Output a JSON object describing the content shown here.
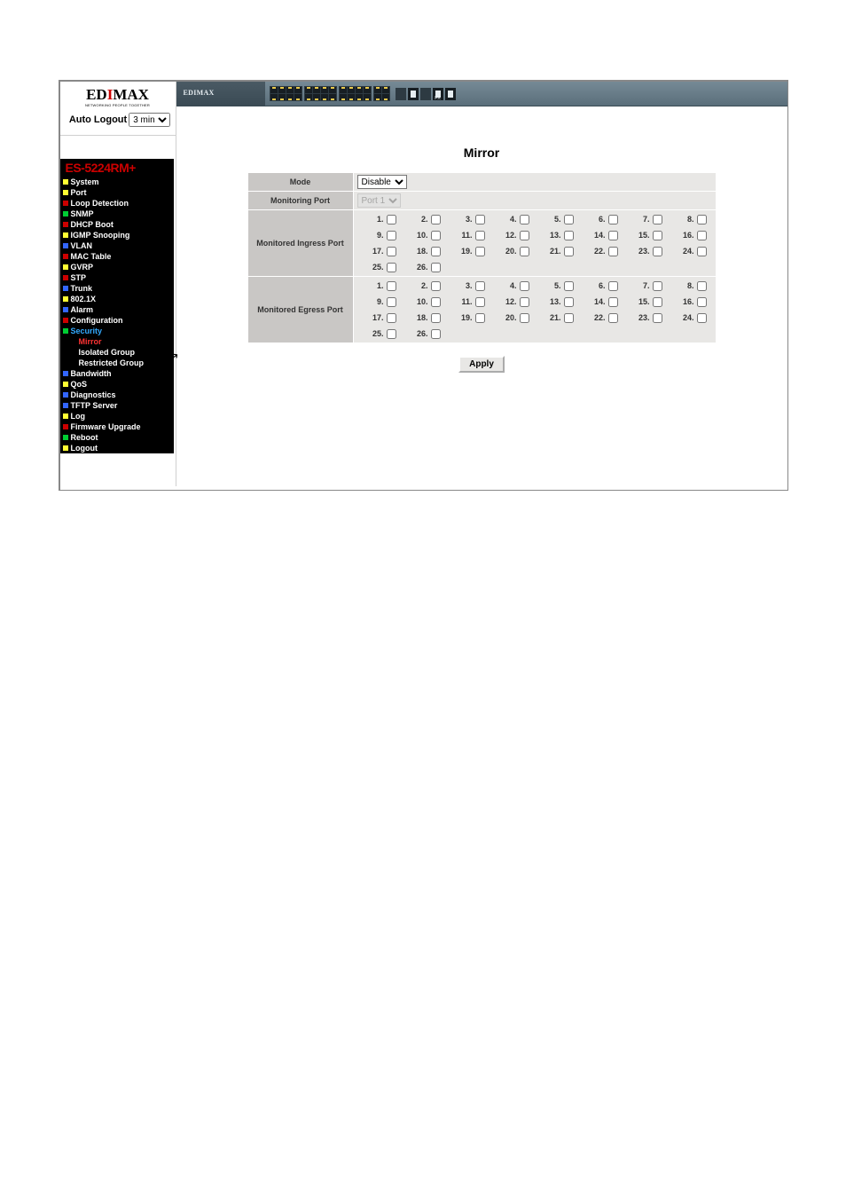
{
  "brand": "EDIMAX",
  "auto_logout_label": "Auto Logout",
  "auto_logout_value": "3 min",
  "model": "ES-5224RM+",
  "nav": [
    {
      "sq": "yellow",
      "cls": "",
      "label": "System"
    },
    {
      "sq": "yellow",
      "cls": "",
      "label": "Port"
    },
    {
      "sq": "red",
      "cls": "",
      "label": "Loop Detection"
    },
    {
      "sq": "green",
      "cls": "",
      "label": "SNMP"
    },
    {
      "sq": "red",
      "cls": "",
      "label": "DHCP Boot"
    },
    {
      "sq": "yellow",
      "cls": "",
      "label": "IGMP Snooping"
    },
    {
      "sq": "blue",
      "cls": "",
      "label": "VLAN"
    },
    {
      "sq": "red",
      "cls": "",
      "label": "MAC Table"
    },
    {
      "sq": "yellow",
      "cls": "",
      "label": "GVRP"
    },
    {
      "sq": "red",
      "cls": "",
      "label": "STP"
    },
    {
      "sq": "blue",
      "cls": "",
      "label": "Trunk"
    },
    {
      "sq": "yellow",
      "cls": "",
      "label": "802.1X"
    },
    {
      "sq": "blue",
      "cls": "",
      "label": "Alarm"
    },
    {
      "sq": "red",
      "cls": "",
      "label": "Configuration"
    },
    {
      "sq": "green",
      "cls": "blue-text",
      "label": "Security"
    },
    {
      "sq": "none",
      "cls": "red-text",
      "label": "Mirror",
      "ind": true
    },
    {
      "sq": "none",
      "cls": "",
      "label": "Isolated Group",
      "ind": true
    },
    {
      "sq": "none",
      "cls": "",
      "label": "Restricted Group",
      "ind": true
    },
    {
      "sq": "blue",
      "cls": "",
      "label": "Bandwidth"
    },
    {
      "sq": "yellow",
      "cls": "",
      "label": "QoS"
    },
    {
      "sq": "blue",
      "cls": "",
      "label": "Diagnostics"
    },
    {
      "sq": "blue",
      "cls": "",
      "label": "TFTP Server"
    },
    {
      "sq": "yellow",
      "cls": "",
      "label": "Log"
    },
    {
      "sq": "red",
      "cls": "",
      "label": "Firmware Upgrade"
    },
    {
      "sq": "green",
      "cls": "",
      "label": "Reboot"
    },
    {
      "sq": "yellow",
      "cls": "",
      "label": "Logout"
    }
  ],
  "page_title": "Mirror",
  "mirror": {
    "mode_label": "Mode",
    "mode_value": "Disable",
    "monitoring_label": "Monitoring Port",
    "monitoring_value": "Port 1",
    "ingress_label": "Monitored Ingress Port",
    "egress_label": "Monitored Egress Port",
    "port_count": 26,
    "apply_label": "Apply"
  },
  "banner_brand": "EDIMAX"
}
